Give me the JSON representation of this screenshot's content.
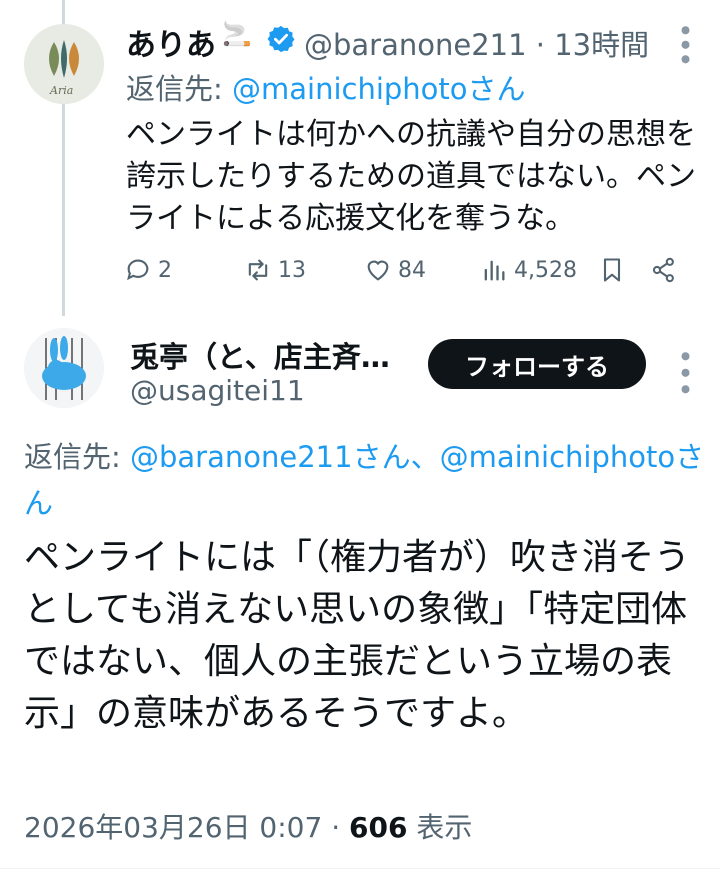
{
  "tweet1": {
    "display_name": "ありあ",
    "smoke_emoji": "🚬",
    "handle": "@baranone211",
    "separator": "·",
    "time": "13時間",
    "reply_prefix": "返信先:",
    "reply_mention": "@mainichiphotoさん",
    "text": "ペンライトは何かへの抗議や自分の思想を誇示したりするための道具ではない。ペンライトによる応援文化を奪うな。",
    "replies": "2",
    "retweets": "13",
    "likes": "84",
    "views": "4,528"
  },
  "tweet2": {
    "display_name": "兎亭（と、店主斉…",
    "handle": "@usagitei11",
    "follow_label": "フォローする",
    "reply_prefix": "返信先:",
    "reply_mentions": "@baranone211さん、@mainichiphotoさん",
    "text": "ペンライトには「（権力者が）吹き消そうとしても消えない思いの象徴」「特定団体ではない、個人の主張だという立場の表示」の意味があるそうですよ。",
    "timestamp": "2026年03月26日 0:07",
    "separator": "·",
    "views_count": "606",
    "views_label": "表示"
  },
  "colors": {
    "text_primary": "#0f1419",
    "text_secondary": "#536471",
    "accent": "#1d9bf0",
    "follow_bg": "#0f1419"
  }
}
